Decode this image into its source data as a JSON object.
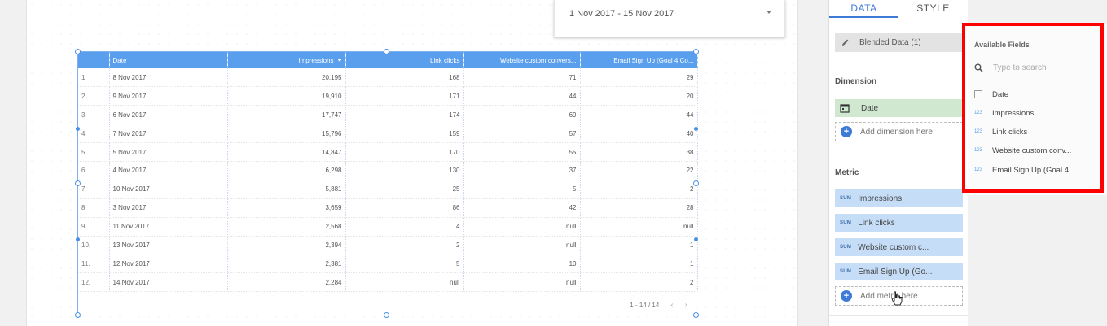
{
  "date_range": {
    "label": "1 Nov 2017 - 15 Nov 2017"
  },
  "table": {
    "headers": [
      "Date",
      "Impressions",
      "Link clicks",
      "Website custom convers...",
      "Email Sign Up (Goal 4 Co..."
    ],
    "rows": [
      [
        "1.",
        "8 Nov 2017",
        "20,195",
        "168",
        "71",
        "29"
      ],
      [
        "2.",
        "9 Nov 2017",
        "19,910",
        "171",
        "44",
        "20"
      ],
      [
        "3.",
        "6 Nov 2017",
        "17,747",
        "174",
        "69",
        "44"
      ],
      [
        "4.",
        "7 Nov 2017",
        "15,796",
        "159",
        "57",
        "40"
      ],
      [
        "5.",
        "5 Nov 2017",
        "14,847",
        "170",
        "55",
        "38"
      ],
      [
        "6.",
        "4 Nov 2017",
        "6,298",
        "130",
        "37",
        "22"
      ],
      [
        "7.",
        "10 Nov 2017",
        "5,881",
        "25",
        "5",
        "2"
      ],
      [
        "8.",
        "3 Nov 2017",
        "3,659",
        "86",
        "42",
        "28"
      ],
      [
        "9.",
        "11 Nov 2017",
        "2,568",
        "4",
        "null",
        "null"
      ],
      [
        "10.",
        "13 Nov 2017",
        "2,394",
        "2",
        "null",
        "1"
      ],
      [
        "11.",
        "12 Nov 2017",
        "2,381",
        "5",
        "10",
        "1"
      ],
      [
        "12.",
        "14 Nov 2017",
        "2,284",
        "null",
        "null",
        "2"
      ]
    ],
    "pagination": "1 - 14 / 14",
    "prev": "‹",
    "next": "›"
  },
  "panel": {
    "tabs": [
      {
        "label": "DATA",
        "active": true
      },
      {
        "label": "STYLE",
        "active": false
      }
    ],
    "data_source": "Blended Data (1)",
    "dimension_label": "Dimension",
    "dimensions": [
      "Date"
    ],
    "add_dimension": "Add dimension here",
    "metric_label": "Metric",
    "metric_agg": "SUM",
    "metrics": [
      "Impressions",
      "Link clicks",
      "Website custom c...",
      "Email Sign Up (Go..."
    ],
    "add_metric": "Add metric here"
  },
  "available_fields": {
    "title": "Available Fields",
    "search_placeholder": "Type to search",
    "type_label": "123",
    "fields": [
      "Date",
      "Impressions",
      "Link clicks",
      "Website custom conv...",
      "Email Sign Up (Goal 4 ..."
    ]
  },
  "colors": {
    "header_blue": "#5a9eee",
    "accent": "#3f7bd6",
    "dimension_chip": "#cfe8cf",
    "metric_chip": "#c6ddf7",
    "highlight": "#ff0000"
  }
}
